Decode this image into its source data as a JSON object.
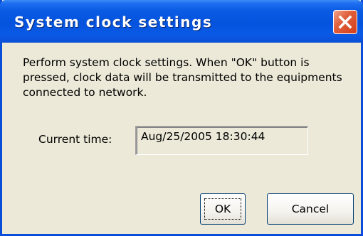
{
  "dialog": {
    "title": "System clock settings",
    "message": "Perform system clock settings. When \"OK\" button is pressed, clock data will be transmitted to the equipments connected to network.",
    "current_time_label": "Current time:",
    "current_time_value": "Aug/25/2005 18:30:44",
    "ok_label": "OK",
    "cancel_label": "Cancel"
  },
  "colors": {
    "titlebar": "#0553dd",
    "close_button": "#d33d18",
    "dialog_background": "#ece9d8"
  },
  "icons": {
    "close": "close-icon"
  }
}
